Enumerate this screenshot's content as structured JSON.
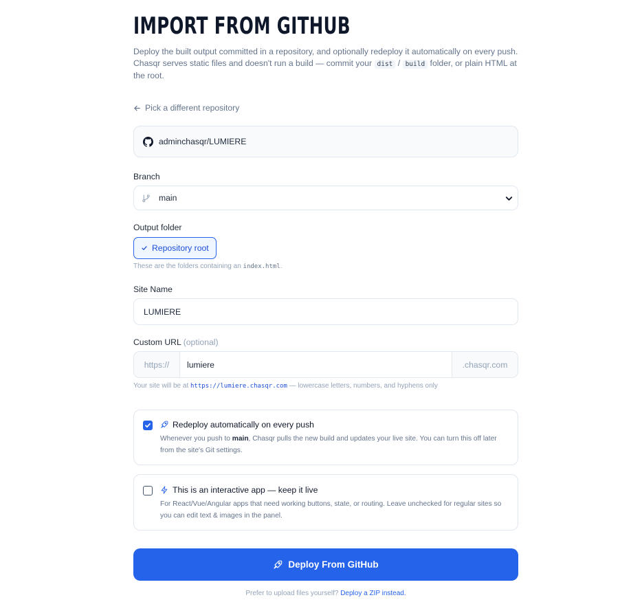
{
  "page": {
    "title": "IMPORT FROM GITHUB",
    "description_before": "Deploy the built output committed in a repository, and optionally redeploy it automatically on every push. Chasqr serves static files and doesn't run a build — commit your ",
    "code_dist": "dist",
    "slash": "/",
    "code_build": "build",
    "description_after": " folder, or plain HTML at the root."
  },
  "back_link": "Pick a different repository",
  "repo": {
    "name": "adminchasqr/LUMIERE",
    "icon": "github-icon"
  },
  "branch": {
    "label": "Branch",
    "value": "main",
    "icon": "git-branch-icon"
  },
  "output_folder": {
    "label": "Output folder",
    "selected": "Repository root",
    "hint_before": "These are the folders containing an ",
    "hint_code": "index.html",
    "hint_after": "."
  },
  "site_name": {
    "label": "Site Name",
    "value": "LUMIERE"
  },
  "custom_url": {
    "label": "Custom URL",
    "optional": "(optional)",
    "prefix": "https://",
    "value": "lumiere",
    "suffix": ".chasqr.com",
    "hint_before": "Your site will be at ",
    "hint_url": "https://lumiere.chasqr.com",
    "hint_after": " — lowercase letters, numbers, and hyphens only"
  },
  "redeploy": {
    "checked": true,
    "title": "Redeploy automatically on every push",
    "body_before": "Whenever you push to ",
    "branch": "main",
    "body_after": ", Chasqr pulls the new build and updates your live site. You can turn this off later from the site's Git settings."
  },
  "interactive": {
    "checked": false,
    "title": "This is an interactive app — keep it live",
    "body": "For React/Vue/Angular apps that need working buttons, state, or routing. Leave unchecked for regular sites so you can edit text & images in the panel."
  },
  "deploy_button": "Deploy From GitHub",
  "footer": {
    "text": "Prefer to upload files yourself? ",
    "link": "Deploy a ZIP instead."
  },
  "colors": {
    "accent": "#2563eb",
    "muted": "#64748b",
    "border": "#e2e8f0"
  }
}
